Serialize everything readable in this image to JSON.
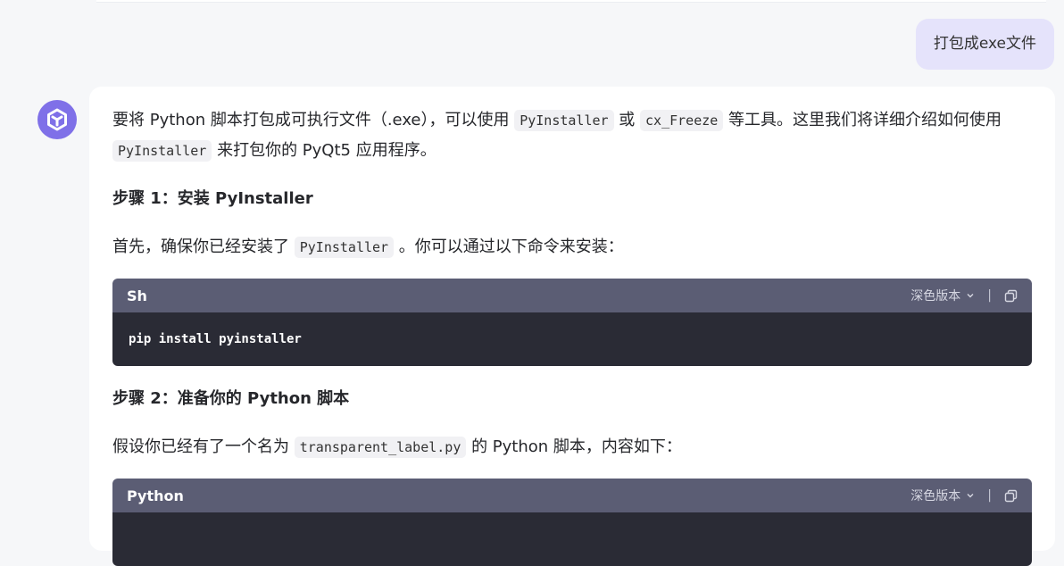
{
  "user_message": {
    "text": "打包成exe文件"
  },
  "assistant": {
    "intro": {
      "t1": "要将 Python 脚本打包成可执行文件（.exe），可以使用 ",
      "c1": "PyInstaller",
      "t2": " 或 ",
      "c2": "cx_Freeze",
      "t3": " 等工具。这里我们将详细介绍如何使用 ",
      "c3": "PyInstaller",
      "t4": " 来打包你的 PyQt5 应用程序。"
    },
    "step1": {
      "heading": "步骤 1：安装 PyInstaller",
      "t1": "首先，确保你已经安装了 ",
      "c1": "PyInstaller",
      "t2": " 。你可以通过以下命令来安装："
    },
    "code1": {
      "lang": "Sh",
      "theme_label": "深色版本",
      "line": "pip install pyinstaller"
    },
    "step2": {
      "heading": "步骤 2：准备你的 Python 脚本",
      "t1": "假设你已经有了一个名为 ",
      "c1": "transparent_label.py",
      "t2": " 的 Python 脚本，内容如下："
    },
    "code2": {
      "lang": "Python",
      "theme_label": "深色版本"
    }
  },
  "colors": {
    "accent": "#7f70e8",
    "user_bubble": "#e5e3fb",
    "code_header": "#5b5d74",
    "code_body": "#2a2b35"
  }
}
